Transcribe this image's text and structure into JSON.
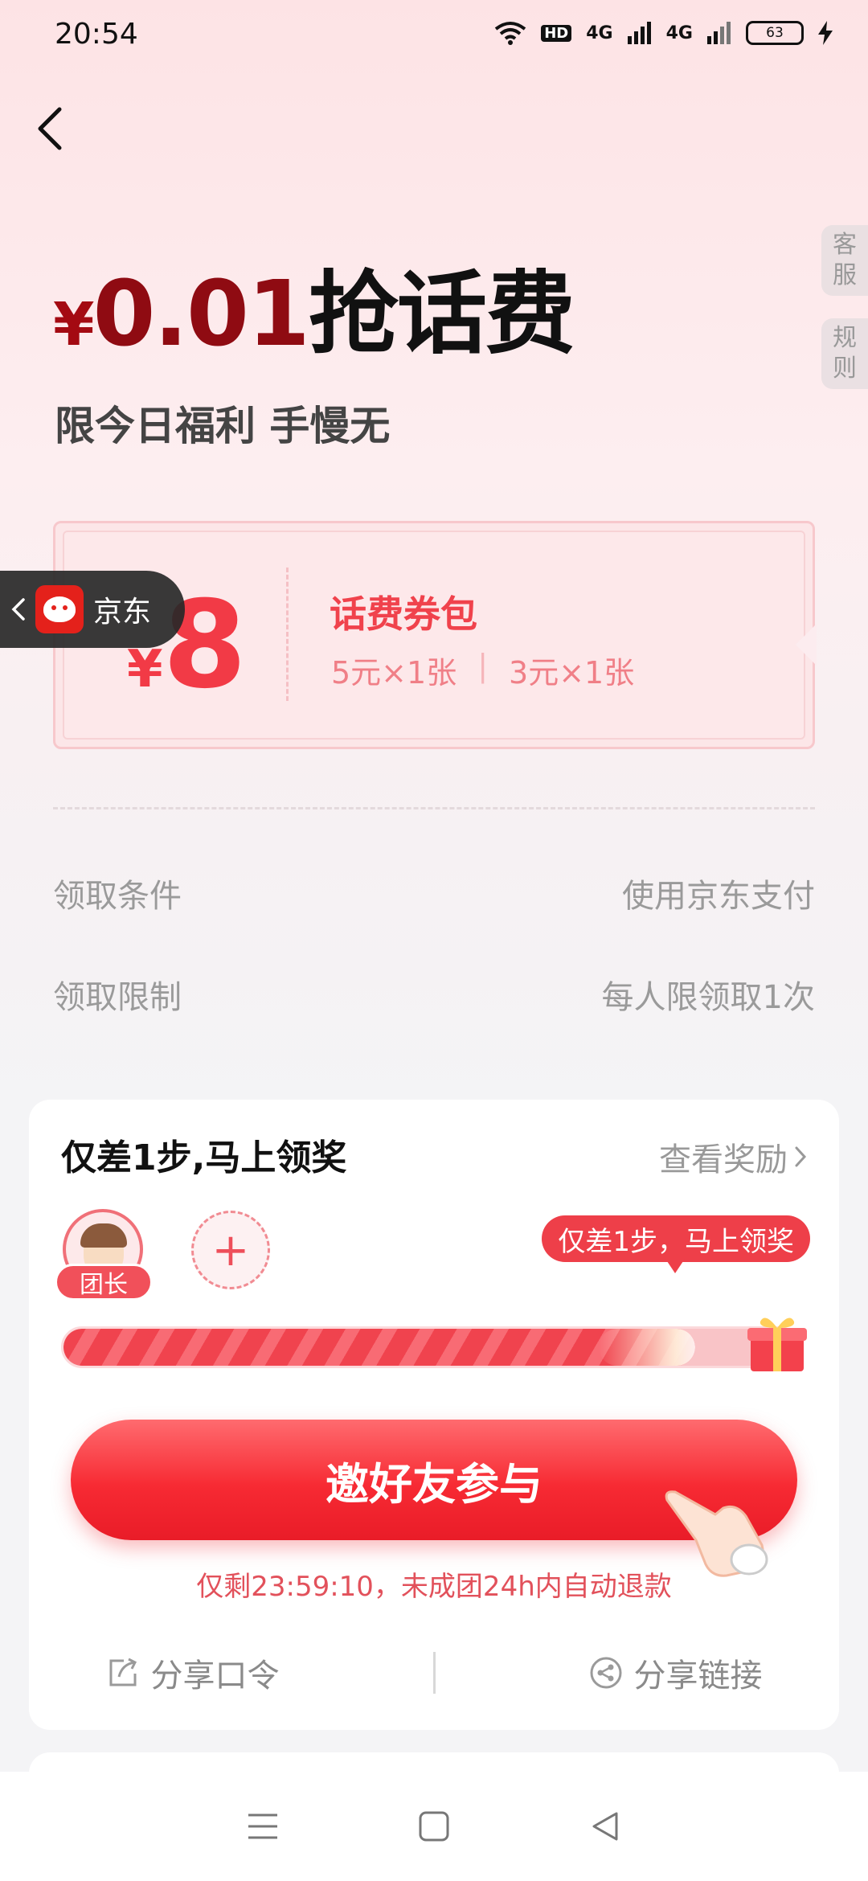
{
  "status_bar": {
    "time": "20:54",
    "network_badge": "HD",
    "signal1": "4G",
    "signal2": "4G",
    "battery": "63"
  },
  "side_buttons": {
    "service": "客服",
    "rules": "规则"
  },
  "hero": {
    "currency": "¥",
    "price": "0.01",
    "title_text": "抢话费",
    "subtitle": "限今日福利 手慢无"
  },
  "coupon": {
    "currency": "¥",
    "amount": "8",
    "title": "话费券包",
    "items": [
      "5元×1张",
      "3元×1张"
    ],
    "separator": "|"
  },
  "jd_pill": {
    "label": "京东"
  },
  "conditions": [
    {
      "label": "领取条件",
      "value": "使用京东支付"
    },
    {
      "label": "领取限制",
      "value": "每人限领取1次"
    }
  ],
  "group_card": {
    "title": "仅差1步,马上领奖",
    "view_rewards": "查看奖励",
    "leader_badge": "团长",
    "add_symbol": "+",
    "tip_bubble": "仅差1步，马上领奖",
    "progress": 0.86,
    "cta_label": "邀好友参与",
    "countdown": "仅剩23:59:10，未成团24h内自动退款",
    "share_command": "分享口令",
    "share_link": "分享链接"
  },
  "colors": {
    "accent_red": "#f23a46",
    "deep_red": "#8f0b12",
    "cta_red": "#f72a33"
  }
}
